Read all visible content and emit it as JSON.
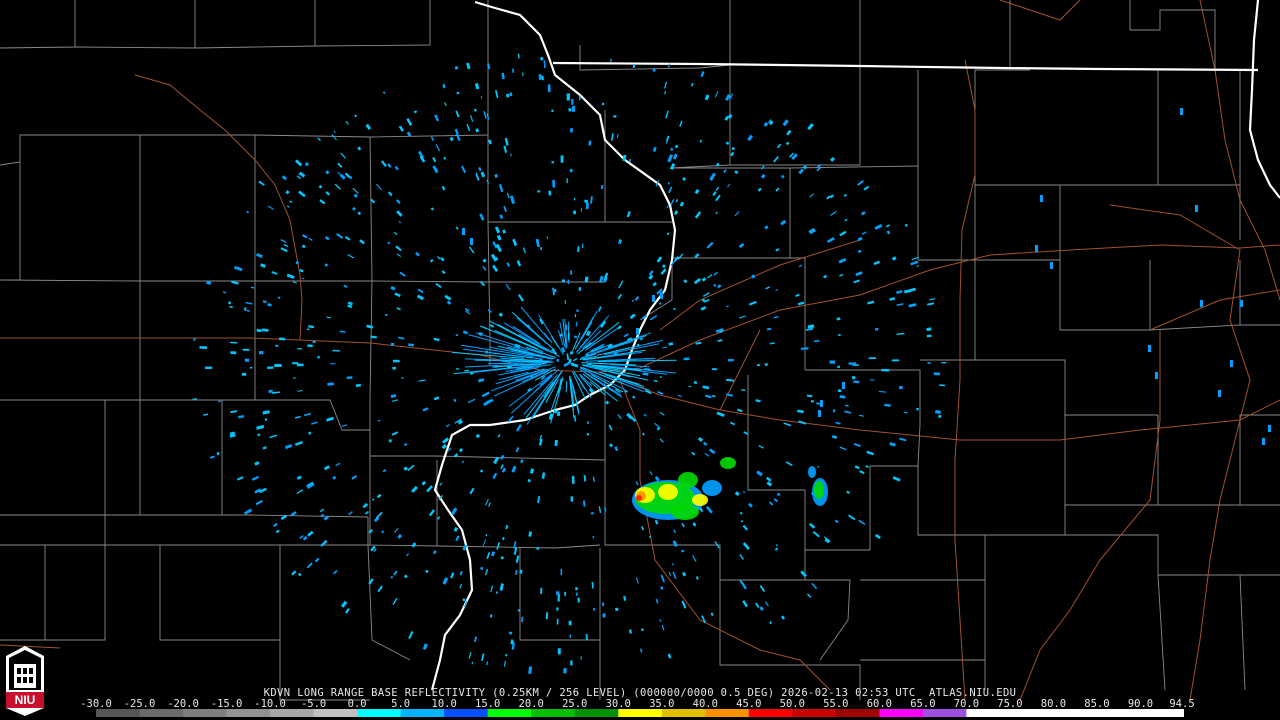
{
  "product": {
    "caption": "KDVN LONG RANGE BASE REFLECTIVITY (0.25KM / 256 LEVEL) (000000/0000 0.5 DEG) 2026-02-13 02:53 UTC  ATLAS.NIU.EDU"
  },
  "logo": {
    "text": "NIU",
    "name": "niu-logo"
  },
  "legend": {
    "ticks": [
      "-30.0",
      "-25.0",
      "-20.0",
      "-15.0",
      "-10.0",
      "-5.0",
      "0.0",
      "5.0",
      "10.0",
      "15.0",
      "20.0",
      "25.0",
      "30.0",
      "35.0",
      "40.0",
      "45.0",
      "50.0",
      "55.0",
      "60.0",
      "65.0",
      "70.0",
      "75.0",
      "80.0",
      "85.0",
      "90.0",
      "94.5"
    ],
    "colors": [
      "#555555",
      "#6b6b6b",
      "#7e7e7e",
      "#929292",
      "#a8a8a8",
      "#c0c0c0",
      "#00ffff",
      "#00b4ff",
      "#0050ff",
      "#00ff00",
      "#00c000",
      "#009000",
      "#ffff00",
      "#e0c000",
      "#ff9000",
      "#ff0000",
      "#c80000",
      "#a00000",
      "#ff00ff",
      "#a050e0",
      "#ffffff",
      "#ffffff",
      "#ffffff",
      "#ffffff",
      "#ffffff"
    ]
  },
  "colors": {
    "background": "#000000",
    "county_lines": "#8a8a8a",
    "state_lines": "#ffffff",
    "highways": "#a0522d",
    "echo_weak": "#00c8ff",
    "echo_mid": "#00a0ff",
    "echo_green": "#00d800",
    "echo_yellow": "#ffff00",
    "echo_orange": "#ff9000",
    "echo_red": "#ff2000"
  }
}
